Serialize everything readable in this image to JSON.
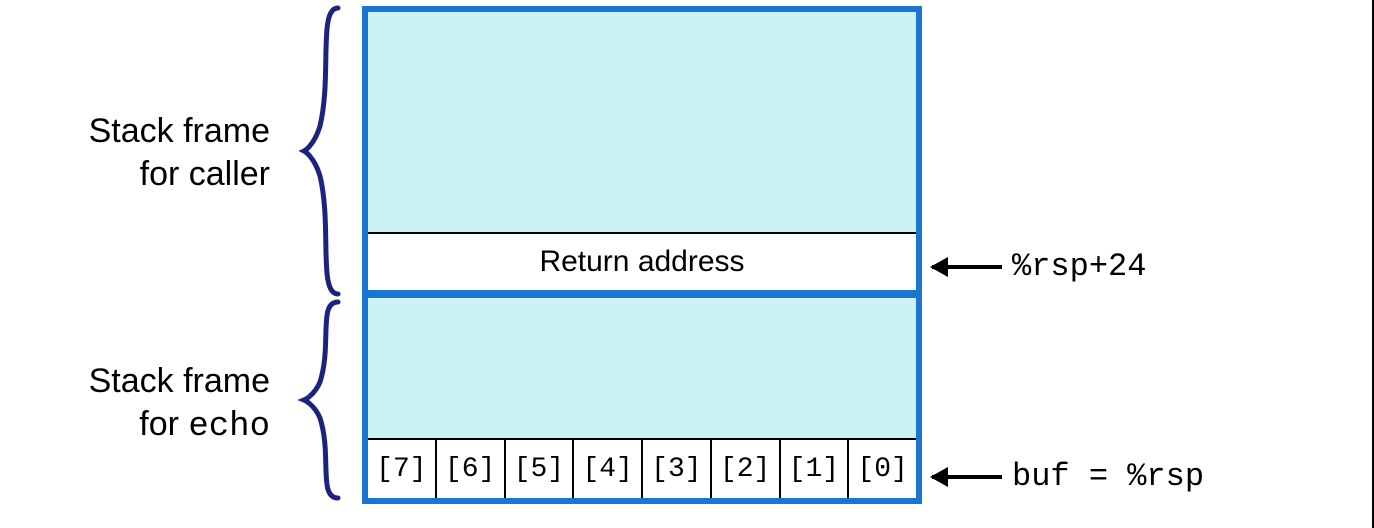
{
  "labels": {
    "caller_line1": "Stack frame",
    "caller_line2": "for caller",
    "echo_line1": "Stack frame",
    "echo_line2_prefix": "for ",
    "echo_line2_mono": "echo"
  },
  "stack": {
    "return_address": "Return address",
    "buf_cells": [
      "[7]",
      "[6]",
      "[5]",
      "[4]",
      "[3]",
      "[2]",
      "[1]",
      "[0]"
    ]
  },
  "pointers": {
    "rsp24": "%rsp+24",
    "buf": "buf = %rsp"
  }
}
